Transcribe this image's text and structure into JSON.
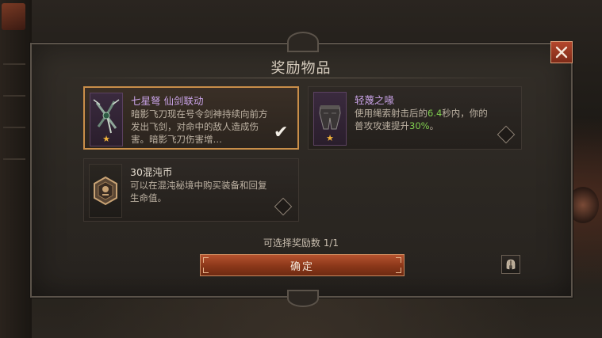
{
  "dialog": {
    "title": "奖励物品",
    "select_count": "可选择奖励数 1/1",
    "confirm_label": "确定"
  },
  "rewards": [
    {
      "name": "七星弩 仙剑联动",
      "name_color": "#c8a2e6",
      "desc": "暗影飞刀现在号令剑神持续向前方发出飞剑，对命中的敌人造成伤害。暗影飞刀伤害增…",
      "icon": "crossbow-icon",
      "rarity_star": "★",
      "selected": true
    },
    {
      "name": "轻蔑之喙",
      "name_color": "#c8a2e6",
      "desc_parts": [
        "使用绳索射击后的",
        "6.4",
        "秒内，你的普攻攻速提升",
        "30%",
        "。"
      ],
      "icon": "armor-pants-icon",
      "rarity_star": "★",
      "selected": false
    },
    {
      "name": "30混沌币",
      "name_color": "#e6ddd0",
      "desc": "可以在混沌秘境中购买装备和回复生命值。",
      "icon": "chaos-coin-icon",
      "selected": false
    }
  ],
  "colors": {
    "accent": "#c98e49",
    "highlight": "#7fce4f",
    "confirm": "#a3431f"
  }
}
